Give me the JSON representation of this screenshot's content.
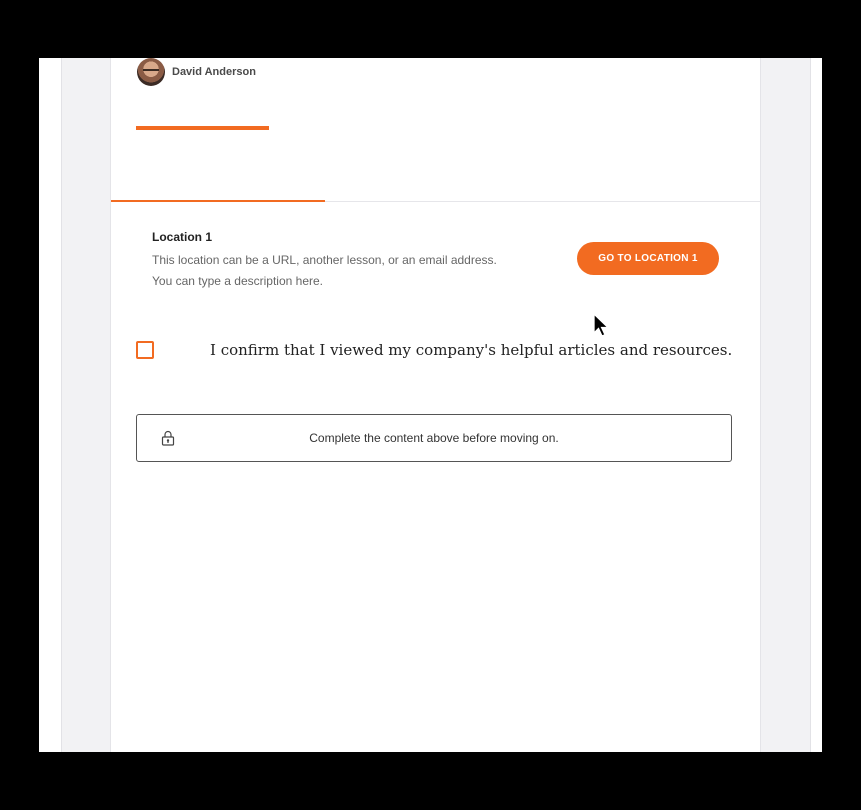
{
  "author": {
    "name": "David Anderson",
    "avatar_icon": "user-avatar"
  },
  "location": {
    "title": "Location 1",
    "description": "This location can be a URL, another lesson, or an email address. You can type a description here.",
    "button_label": "GO TO LOCATION 1"
  },
  "confirm": {
    "checked": false,
    "text": "I confirm that I viewed my company's helpful articles and resources."
  },
  "locked": {
    "icon": "lock-icon",
    "text": "Complete the content above before moving on."
  },
  "colors": {
    "accent": "#f26b21",
    "background": "#f2f2f4",
    "card": "#ffffff"
  }
}
